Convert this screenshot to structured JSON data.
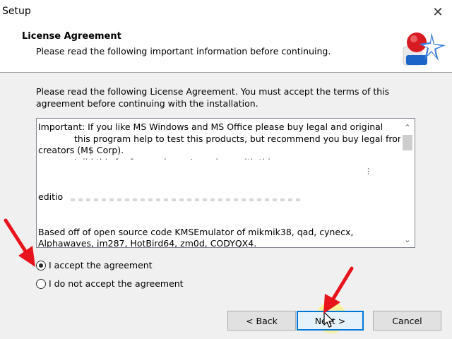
{
  "window": {
    "title": "Setup",
    "close_symbol": "✕"
  },
  "header": {
    "title": "License Agreement",
    "subtitle": "Please read the following important information before continuing."
  },
  "intro_text": "Please read the following License Agreement. You must accept the terms of this agreement before continuing with the installation.",
  "license": {
    "line1": "Important: If you like MS Windows and MS Office please buy legal and original",
    "line2": "this program help to test this products, but recommend you buy legal from",
    "line3": "creators (M$ Corp).",
    "line4": "I did this for fun, and now I am done with this",
    "line5": "editio",
    "line6": "Based off of open source code KMSEmulator of mikmik38, qad, cynecx,",
    "line7": "Alphawaves, jm287, HotBird64, zm0d, CODYQX4."
  },
  "options": {
    "accept_label": "I accept the agreement",
    "decline_label": "I do not accept the agreement",
    "selected": "accept"
  },
  "buttons": {
    "back": "< Back",
    "next": "Next >",
    "cancel": "Cancel"
  },
  "colors": {
    "annotation_arrow": "#e8141c",
    "focus_border": "#0078d7",
    "cursor_highlight": "#fff082"
  }
}
